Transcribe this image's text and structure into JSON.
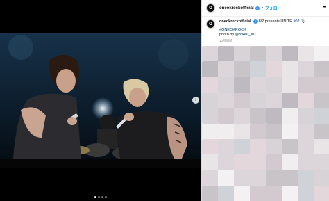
{
  "post": {
    "account": "oneokrockofficial",
    "follow_label": "フォロー",
    "separator": "•",
    "caption_text": "8/2 presents UNITE",
    "caption_hashtag": "#02 🎙",
    "hashtag_line": "#ONEOKROCK",
    "photo_by_label": "photo by",
    "photo_by_handle": "@rokku_jin1",
    "time_ago": "10時間前",
    "carousel_pages": 4,
    "carousel_active": 0
  },
  "colors": {
    "verified": "#3897f0",
    "link": "#00376b",
    "follow": "#0095f6"
  },
  "icons": {
    "menu": "more-options-icon",
    "verified": "verified-badge-icon",
    "next": "chevron-right-icon"
  }
}
